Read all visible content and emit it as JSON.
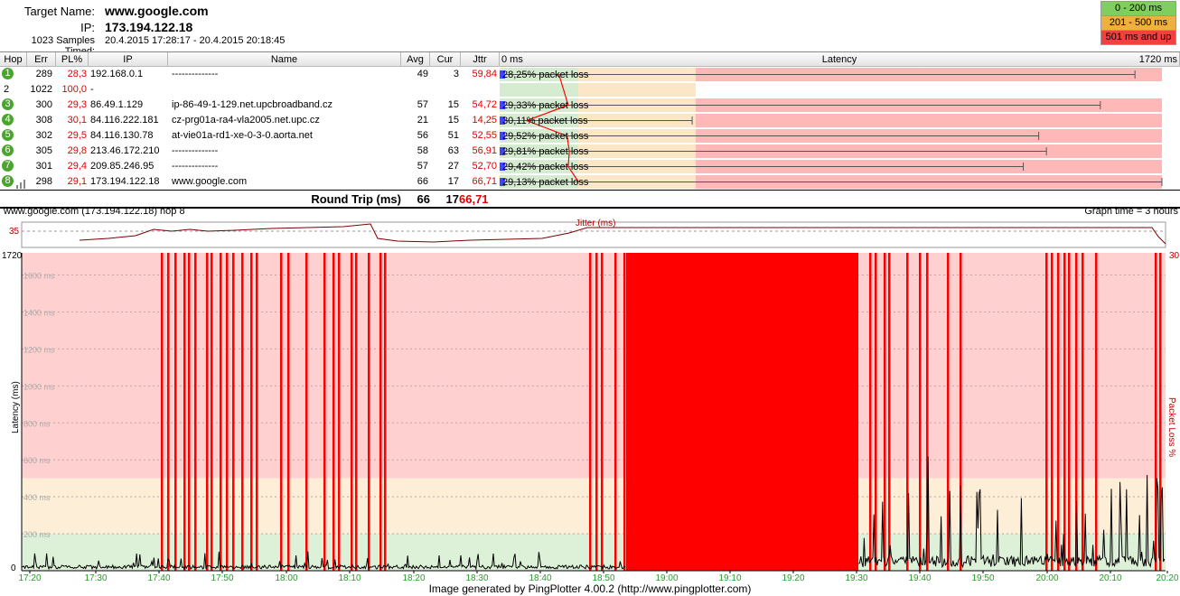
{
  "header": {
    "target_label": "Target Name:",
    "target_value": "www.google.com",
    "ip_label": "IP:",
    "ip_value": "173.194.122.18",
    "samples_label": "1023 Samples Timed:",
    "samples_value": "20.4.2015 17:28:17 - 20.4.2015 20:18:45"
  },
  "legend": [
    {
      "label": "0 - 200 ms",
      "color": "#7fcf5f"
    },
    {
      "label": "201 - 500 ms",
      "color": "#f0b040"
    },
    {
      "label": "501 ms and up",
      "color": "#f04040"
    }
  ],
  "columns": {
    "hop": "Hop",
    "err": "Err",
    "pl": "PL%",
    "ip": "IP",
    "name": "Name",
    "avg": "Avg",
    "cur": "Cur",
    "jttr": "Jttr",
    "latency": "Latency",
    "scale_min": "0 ms",
    "scale_max": "1720 ms"
  },
  "hops": [
    {
      "hop": "1",
      "err": "289",
      "pl": "28,3",
      "ip": "192.168.0.1",
      "name": "--------------",
      "avg": "49",
      "cur": "3",
      "jttr": "59,84",
      "loss": "28,25% packet loss",
      "badge": true,
      "loss_pct": 28.25,
      "max_ms": 1650
    },
    {
      "hop": "2",
      "err": "1022",
      "pl": "100,0",
      "ip": "-",
      "name": "",
      "avg": "",
      "cur": "",
      "jttr": "",
      "loss": "",
      "badge": false,
      "loss_pct": 100,
      "max_ms": 0
    },
    {
      "hop": "3",
      "err": "300",
      "pl": "29,3",
      "ip": "86.49.1.129",
      "name": "ip-86-49-1-129.net.upcbroadband.cz",
      "avg": "57",
      "cur": "15",
      "jttr": "54,72",
      "loss": "29,33% packet loss",
      "badge": true,
      "loss_pct": 29.33,
      "max_ms": 1560
    },
    {
      "hop": "4",
      "err": "308",
      "pl": "30,1",
      "ip": "84.116.222.181",
      "name": "cz-prg01a-ra4-vla2005.net.upc.cz",
      "avg": "21",
      "cur": "15",
      "jttr": "14,25",
      "loss": "30,11% packet loss",
      "badge": true,
      "loss_pct": 30.11,
      "max_ms": 500
    },
    {
      "hop": "5",
      "err": "302",
      "pl": "29,5",
      "ip": "84.116.130.78",
      "name": "at-vie01a-rd1-xe-0-3-0.aorta.net",
      "avg": "56",
      "cur": "51",
      "jttr": "52,55",
      "loss": "29,52% packet loss",
      "badge": true,
      "loss_pct": 29.52,
      "max_ms": 1400
    },
    {
      "hop": "6",
      "err": "305",
      "pl": "29,8",
      "ip": "213.46.172.210",
      "name": "--------------",
      "avg": "58",
      "cur": "63",
      "jttr": "56,91",
      "loss": "29,81% packet loss",
      "badge": true,
      "loss_pct": 29.81,
      "max_ms": 1420
    },
    {
      "hop": "7",
      "err": "301",
      "pl": "29,4",
      "ip": "209.85.246.95",
      "name": "--------------",
      "avg": "57",
      "cur": "27",
      "jttr": "52,70",
      "loss": "29,42% packet loss",
      "badge": true,
      "loss_pct": 29.42,
      "max_ms": 1360
    },
    {
      "hop": "8",
      "err": "298",
      "pl": "29,1",
      "ip": "173.194.122.18",
      "name": "www.google.com",
      "avg": "66",
      "cur": "17",
      "jttr": "66,71",
      "loss": "29,13% packet loss",
      "badge": true,
      "loss_pct": 29.13,
      "max_ms": 1720
    }
  ],
  "round_trip": {
    "label": "Round Trip (ms)",
    "avg": "66",
    "cur": "17",
    "jttr": "66,71"
  },
  "graph": {
    "title": "www.google.com (173.194.122.18) hop 8",
    "time_label": "Graph time = 3 hours",
    "jitter_label": "Jitter (ms)",
    "jitter_tick": "35",
    "y_top": "1720",
    "y_bottom": "0",
    "y_axis_label": "Latency (ms)",
    "right_top": "30",
    "right_axis_label": "Packet Loss %",
    "y_ticks": [
      "200 ms",
      "400 ms",
      "600 ms",
      "800 ms",
      "1000 ms",
      "1200 ms",
      "1400 ms",
      "1600 ms"
    ],
    "x_ticks": [
      "17:20",
      "17:30",
      "17:40",
      "17:50",
      "18:00",
      "18:10",
      "18:20",
      "18:30",
      "18:40",
      "18:50",
      "19:00",
      "19:10",
      "19:20",
      "19:30",
      "19:40",
      "19:50",
      "20:00",
      "20:10",
      "20:20"
    ]
  },
  "footer": "Image generated by PingPlotter 4.00.2 (http://www.pingplotter.com)"
}
